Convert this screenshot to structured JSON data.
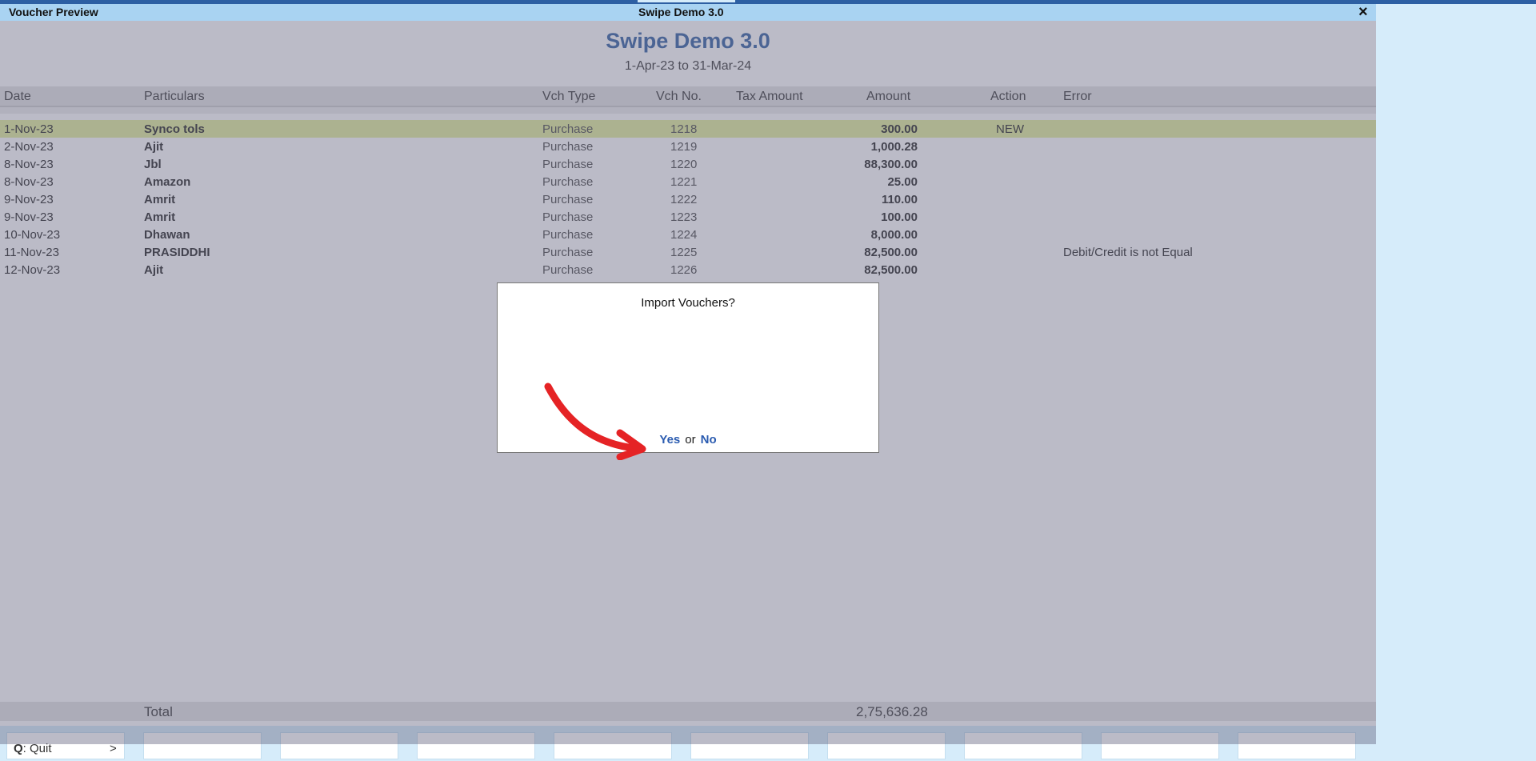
{
  "window": {
    "title": "Voucher Preview",
    "center_title": "Swipe Demo 3.0",
    "close_glyph": "×"
  },
  "report": {
    "company": "Swipe Demo 3.0",
    "period": "1-Apr-23 to 31-Mar-24"
  },
  "columns": {
    "date": "Date",
    "particulars": "Particulars",
    "vch_type": "Vch Type",
    "vch_no": "Vch No.",
    "tax_amount": "Tax Amount",
    "amount": "Amount",
    "action": "Action",
    "error": "Error"
  },
  "rows": [
    {
      "date": "1-Nov-23",
      "particulars": "Synco tols",
      "vch_type": "Purchase",
      "vch_no": "1218",
      "amount": "300.00",
      "action": "NEW",
      "error": ""
    },
    {
      "date": "2-Nov-23",
      "particulars": "Ajit",
      "vch_type": "Purchase",
      "vch_no": "1219",
      "amount": "1,000.28",
      "action": "",
      "error": ""
    },
    {
      "date": "8-Nov-23",
      "particulars": "Jbl",
      "vch_type": "Purchase",
      "vch_no": "1220",
      "amount": "88,300.00",
      "action": "",
      "error": ""
    },
    {
      "date": "8-Nov-23",
      "particulars": "Amazon",
      "vch_type": "Purchase",
      "vch_no": "1221",
      "amount": "25.00",
      "action": "",
      "error": ""
    },
    {
      "date": "9-Nov-23",
      "particulars": "Amrit",
      "vch_type": "Purchase",
      "vch_no": "1222",
      "amount": "110.00",
      "action": "",
      "error": ""
    },
    {
      "date": "9-Nov-23",
      "particulars": "Amrit",
      "vch_type": "Purchase",
      "vch_no": "1223",
      "amount": "100.00",
      "action": "",
      "error": ""
    },
    {
      "date": "10-Nov-23",
      "particulars": "Dhawan",
      "vch_type": "Purchase",
      "vch_no": "1224",
      "amount": "8,000.00",
      "action": "",
      "error": ""
    },
    {
      "date": "11-Nov-23",
      "particulars": "PRASIDDHI",
      "vch_type": "Purchase",
      "vch_no": "1225",
      "amount": "82,500.00",
      "action": "",
      "error": "Debit/Credit is not Equal"
    },
    {
      "date": "12-Nov-23",
      "particulars": "Ajit",
      "vch_type": "Purchase",
      "vch_no": "1226",
      "amount": "82,500.00",
      "action": "",
      "error": ""
    }
  ],
  "total": {
    "label": "Total",
    "amount": "2,75,636.28"
  },
  "buttons": [
    {
      "key": "Q",
      "label": ": Quit",
      "arrow": ">"
    },
    {
      "key": "",
      "label": "",
      "arrow": ""
    },
    {
      "key": "",
      "label": "",
      "arrow": ""
    },
    {
      "key": "",
      "label": "",
      "arrow": ""
    },
    {
      "key": "",
      "label": "",
      "arrow": ""
    },
    {
      "key": "",
      "label": "",
      "arrow": ""
    },
    {
      "key": "",
      "label": "",
      "arrow": ""
    },
    {
      "key": "",
      "label": "",
      "arrow": ""
    },
    {
      "key": "",
      "label": "",
      "arrow": ""
    },
    {
      "key": "",
      "label": "",
      "arrow": ""
    }
  ],
  "dialog": {
    "question": "Import Vouchers?",
    "yes": "Yes",
    "or": "or",
    "no": "No"
  },
  "colors": {
    "accent": "#2a5bb0",
    "titlebar": "#a9d3f2",
    "annotation_arrow": "#e52325"
  }
}
